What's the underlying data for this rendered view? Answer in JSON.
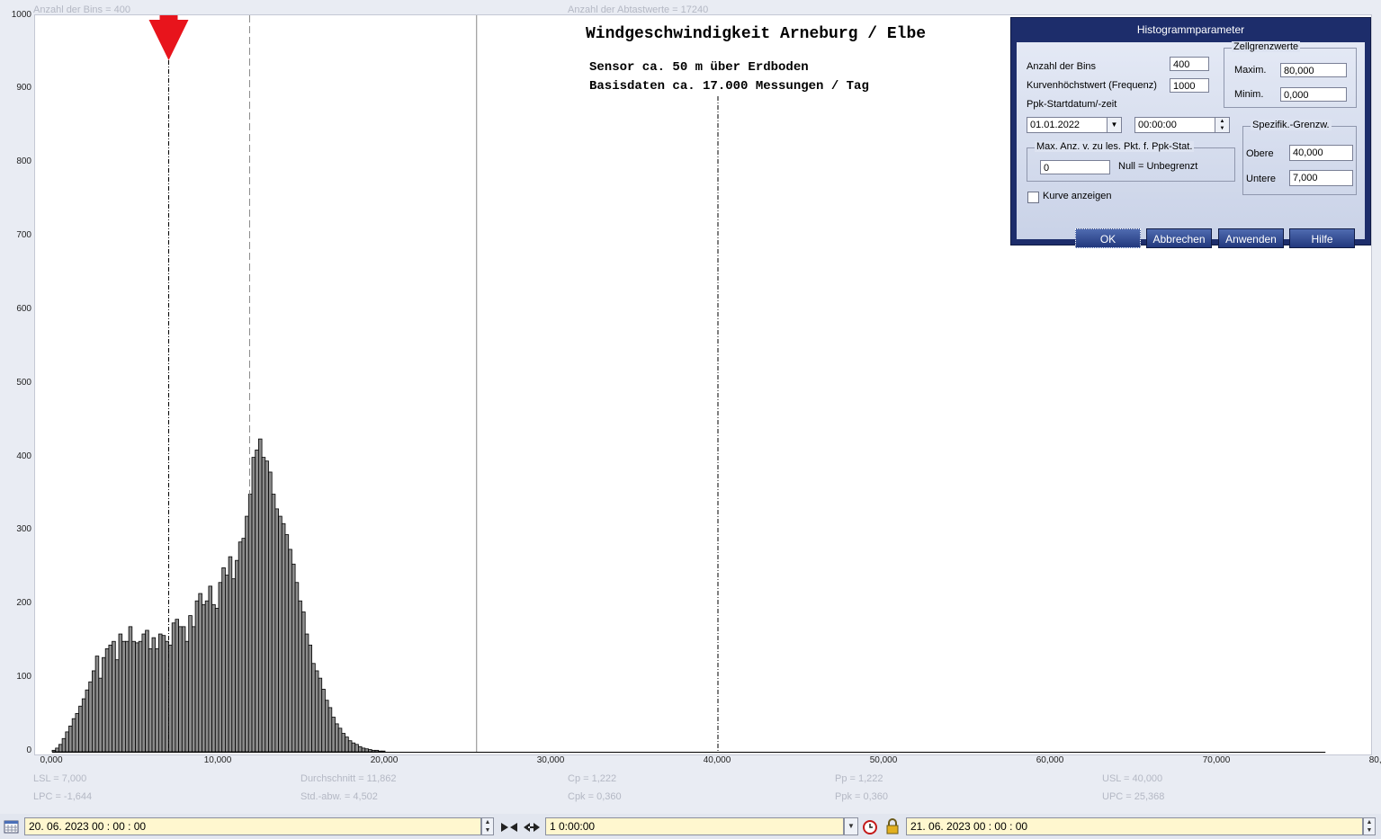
{
  "top_info": {
    "bins_label": "Anzahl der Bins =   400",
    "samples_label": "Anzahl der Abtastwerte = 17240"
  },
  "chart_title": {
    "title": "Windgeschwindigkeit  Arneburg / Elbe",
    "line1": "Sensor ca. 50 m über Erdboden",
    "line2": "Basisdaten ca. 17.000 Messungen / Tag"
  },
  "chart_data": {
    "type": "bar",
    "title": "Windgeschwindigkeit  Arneburg / Elbe",
    "xlim": [
      0,
      80
    ],
    "ylim": [
      0,
      1000
    ],
    "grid": false,
    "y_ticks": [
      "1000",
      "900",
      "800",
      "700",
      "600",
      "500",
      "400",
      "300",
      "200",
      "100",
      "0"
    ],
    "x_ticks": [
      "0,000",
      "10,000",
      "20,000",
      "30,000",
      "40,000",
      "50,000",
      "60,000",
      "70,000",
      "80,000"
    ],
    "x_tick_values": [
      0,
      10,
      20,
      30,
      40,
      50,
      60,
      70,
      80
    ],
    "bin_width": 0.2,
    "bin_start": 0,
    "values": [
      2,
      5,
      10,
      18,
      27,
      35,
      45,
      52,
      62,
      72,
      84,
      95,
      110,
      130,
      100,
      128,
      140,
      145,
      150,
      125,
      160,
      150,
      150,
      170,
      150,
      148,
      150,
      160,
      165,
      140,
      155,
      140,
      160,
      158,
      150,
      145,
      175,
      180,
      170,
      170,
      150,
      185,
      170,
      205,
      215,
      200,
      205,
      225,
      200,
      195,
      230,
      250,
      240,
      265,
      235,
      260,
      285,
      290,
      320,
      350,
      400,
      410,
      425,
      400,
      395,
      380,
      350,
      330,
      320,
      310,
      295,
      275,
      255,
      230,
      205,
      190,
      160,
      145,
      120,
      110,
      100,
      85,
      70,
      60,
      47,
      38,
      32,
      25,
      20,
      15,
      12,
      10,
      7,
      5,
      4,
      3,
      2,
      2,
      1,
      1
    ],
    "markers": {
      "lsl": 7.0,
      "mean": 11.862,
      "ppk_boundary": 25.5,
      "usl": 40.0
    }
  },
  "stats": {
    "lsl": "LSL = 7,000",
    "lpc": "LPC = -1,644",
    "mean": "Durchschnitt  = 11,862",
    "std": "Std.-abw. = 4,502",
    "cp": "Cp  = 1,222",
    "cpk": "Cpk = 0,360",
    "pp": "Pp  = 1,222",
    "ppk": "Ppk = 0,360",
    "usl": "USL = 40,000",
    "upc": "UPC = 25,368"
  },
  "dialog": {
    "title": "Histogrammparameter",
    "bins_label": "Anzahl der Bins",
    "bins_value": "400",
    "maxfreq_label": "Kurvenhöchstwert (Frequenz)",
    "maxfreq_value": "1000",
    "ppk_label": "Ppk-Startdatum/-zeit",
    "ppk_date": "01.01.2022",
    "ppk_time": "00:00:00",
    "maxcount_group": "Max. Anz. v. zu les. Pkt. f. Ppk-Stat.",
    "maxcount_value": "0",
    "maxcount_hint": "Null = Unbegrenzt",
    "cells_group": "Zellgrenzwerte",
    "cells_max_label": "Maxim.",
    "cells_max_value": "80,000",
    "cells_min_label": "Minim.",
    "cells_min_value": "0,000",
    "spec_group": "Spezifik.-Grenzw.",
    "spec_upper_label": "Obere",
    "spec_upper_value": "40,000",
    "spec_lower_label": "Untere",
    "spec_lower_value": "7,000",
    "show_curve_label": "Kurve anzeigen",
    "show_curve_checked": false,
    "ok": "OK",
    "cancel": "Abbrechen",
    "apply": "Anwenden",
    "help": "Hilfe"
  },
  "bottom_bar": {
    "start_datetime": "20. 06. 2023   00 : 00 : 00",
    "interval": "1 0:00:00",
    "end_datetime": "21. 06. 2023   00 : 00 : 00"
  },
  "colors": {
    "bar_fill": "#8c8c8c",
    "marker": "#e8141c",
    "dialog_title_bg": "#1d2d6b",
    "field_bg": "#fff7cf"
  }
}
